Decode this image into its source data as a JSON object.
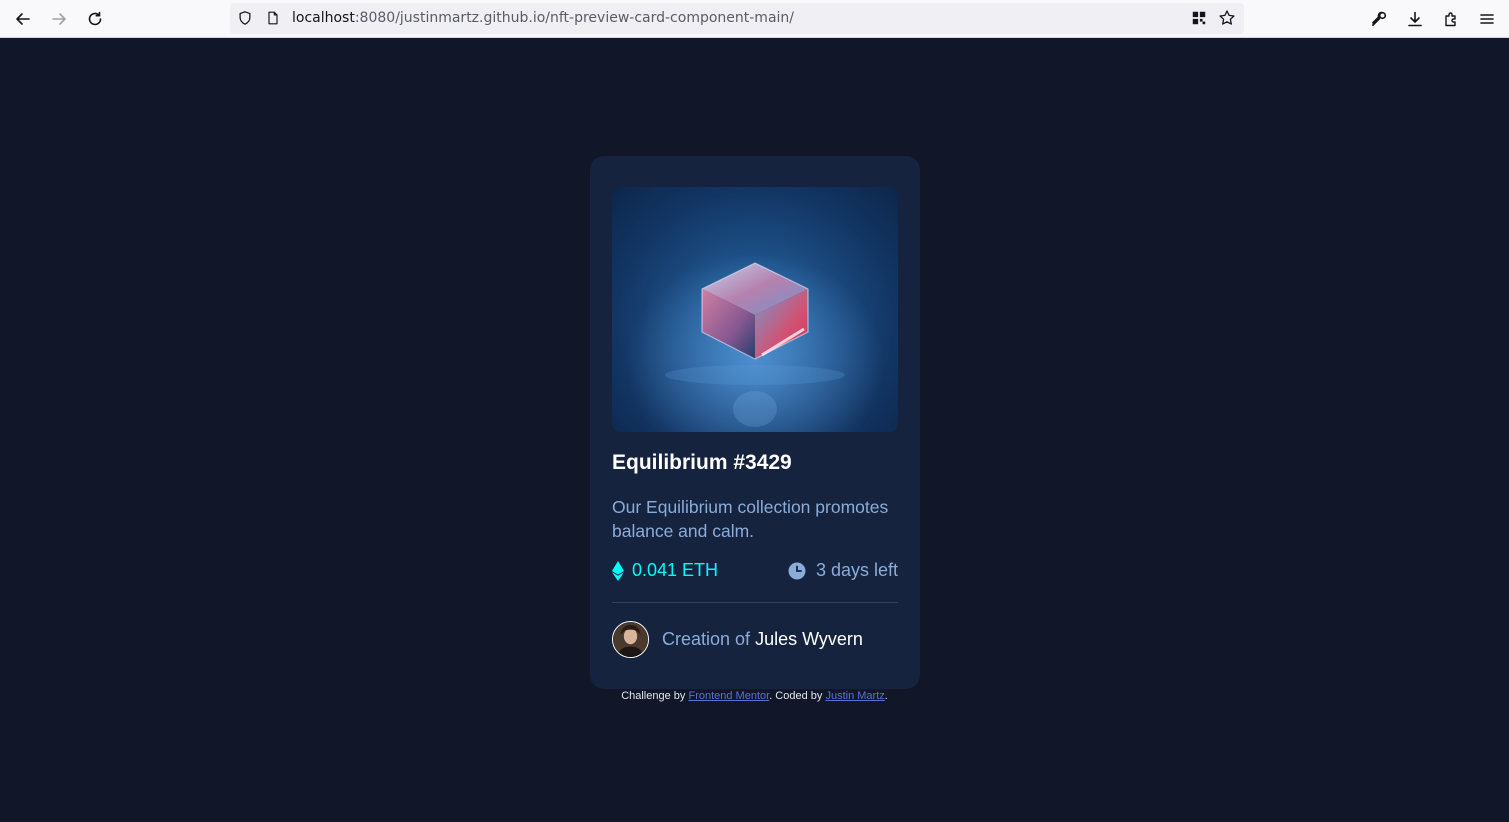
{
  "browser": {
    "url_host": "localhost",
    "url_rest": ":8080/justinmartz.github.io/nft-preview-card-component-main/",
    "icons": [
      "back-arrow-icon",
      "forward-arrow-icon",
      "reload-icon",
      "shield-icon",
      "page-icon",
      "qr-code-icon",
      "bookmark-star-icon",
      "wrench-icon",
      "download-icon",
      "extensions-icon",
      "menu-icon"
    ]
  },
  "card": {
    "image_alt": "Equilibrium",
    "title": "Equilibrium #3429",
    "description": "Our Equilibrium collection promotes balance and calm.",
    "price": "0.041 ETH",
    "time_left": "3 days left",
    "creator_prefix": "Creation of ",
    "creator_name": "Jules Wyvern"
  },
  "attribution": {
    "prefix": "Challenge by ",
    "link1": "Frontend Mentor",
    "middle": ". Coded by ",
    "link2": "Justin Martz",
    "suffix": "."
  },
  "colors": {
    "page_bg": "#111729",
    "card_bg": "#15233e",
    "accent_cyan": "#00fff8",
    "soft_blue": "#8bacd9",
    "white": "#ffffff"
  }
}
